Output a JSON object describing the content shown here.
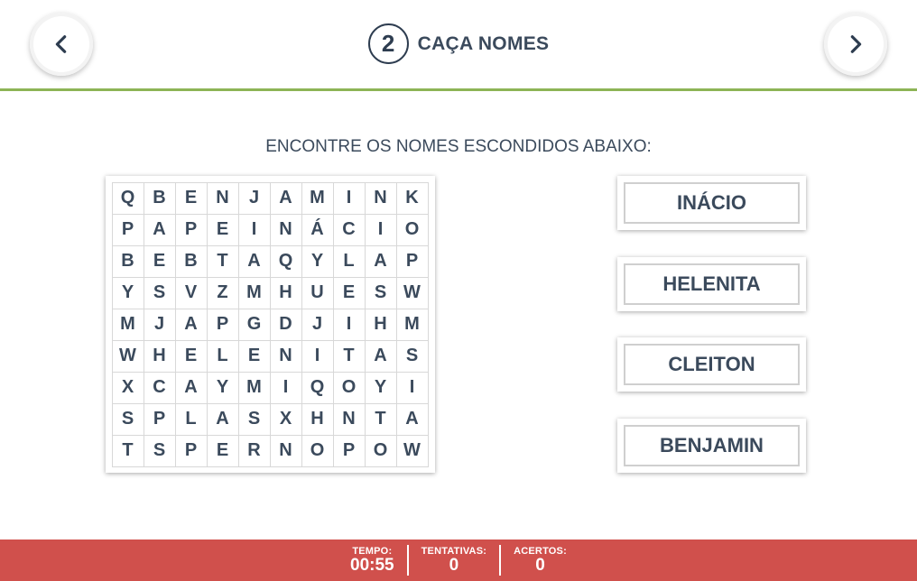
{
  "header": {
    "step_number": "2",
    "title": "CAÇA NOMES",
    "prev_icon": "chevron-left-icon",
    "next_icon": "chevron-right-icon",
    "accent_color": "#8db456"
  },
  "instruction": "ENCONTRE OS NOMES ESCONDIDOS ABAIXO:",
  "grid": [
    [
      "Q",
      "B",
      "E",
      "N",
      "J",
      "A",
      "M",
      "I",
      "N",
      "K"
    ],
    [
      "P",
      "A",
      "P",
      "E",
      "I",
      "N",
      "Á",
      "C",
      "I",
      "O"
    ],
    [
      "B",
      "E",
      "B",
      "T",
      "A",
      "Q",
      "Y",
      "L",
      "A",
      "P"
    ],
    [
      "Y",
      "S",
      "V",
      "Z",
      "M",
      "H",
      "U",
      "E",
      "S",
      "W"
    ],
    [
      "M",
      "J",
      "A",
      "P",
      "G",
      "D",
      "J",
      "I",
      "H",
      "M"
    ],
    [
      "W",
      "H",
      "E",
      "L",
      "E",
      "N",
      "I",
      "T",
      "A",
      "S"
    ],
    [
      "X",
      "C",
      "A",
      "Y",
      "M",
      "I",
      "Q",
      "O",
      "Y",
      "I"
    ],
    [
      "S",
      "P",
      "L",
      "A",
      "S",
      "X",
      "H",
      "N",
      "T",
      "A"
    ],
    [
      "T",
      "S",
      "P",
      "E",
      "R",
      "N",
      "O",
      "P",
      "O",
      "W"
    ]
  ],
  "words": [
    "INÁCIO",
    "HELENITA",
    "CLEITON",
    "BENJAMIN"
  ],
  "footer": {
    "background_color": "#d0504c",
    "time_label": "TEMPO:",
    "time_value": "00:55",
    "attempts_label": "TENTATIVAS:",
    "attempts_value": "0",
    "hits_label": "ACERTOS:",
    "hits_value": "0"
  }
}
